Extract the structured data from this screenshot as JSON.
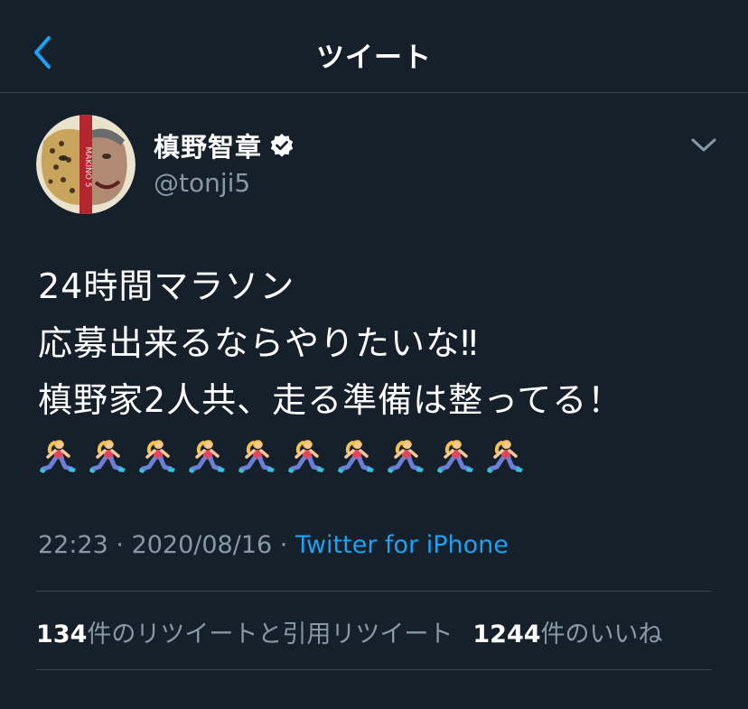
{
  "nav": {
    "title": "ツイート"
  },
  "author": {
    "name": "槙野智章",
    "handle": "@tonji5",
    "verified": true,
    "avatar_text": "MAKINO 5"
  },
  "tweet": {
    "lines": [
      "24時間マラソン",
      "応募出来るならやりたいな‼︎",
      "槙野家2人共、走る準備は整ってる！"
    ],
    "emoji_count": 10,
    "emoji": "woman-running-emoji"
  },
  "meta": {
    "time": "22:23",
    "date": "2020/08/16",
    "separator": " · ",
    "source": "Twitter for iPhone"
  },
  "stats": {
    "retweets_count": "134",
    "retweets_label": "件のリツイートと引用リツイート",
    "likes_count": "1244",
    "likes_label": "件のいいね"
  },
  "colors": {
    "background": "#15202b",
    "accent": "#1da1f2",
    "secondary_text": "#8899a6",
    "divider": "#38444d"
  }
}
